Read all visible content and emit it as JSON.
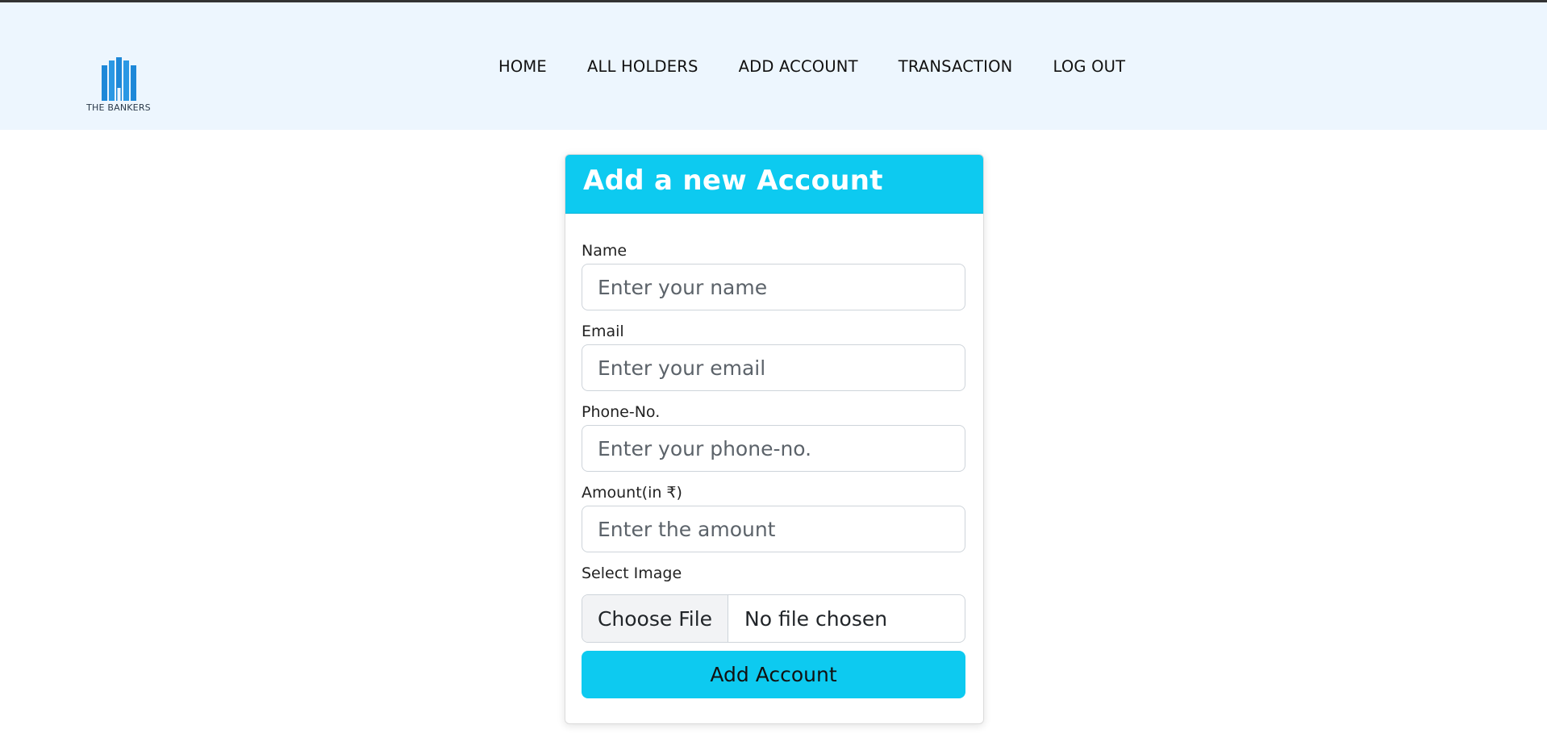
{
  "brand": {
    "name": "THE BANKERS",
    "logo_icon": "building-logo-icon",
    "logo_color": "#1e88d8"
  },
  "nav": {
    "items": [
      {
        "label": "HOME"
      },
      {
        "label": "ALL HOLDERS"
      },
      {
        "label": "ADD ACCOUNT"
      },
      {
        "label": "TRANSACTION"
      },
      {
        "label": "LOG OUT"
      }
    ]
  },
  "form": {
    "title": "Add a new Account",
    "fields": {
      "name": {
        "label": "Name",
        "placeholder": "Enter your name",
        "value": ""
      },
      "email": {
        "label": "Email",
        "placeholder": "Enter your email",
        "value": ""
      },
      "phone": {
        "label": "Phone-No.",
        "placeholder": "Enter your phone-no.",
        "value": ""
      },
      "amount": {
        "label": "Amount(in ₹)",
        "placeholder": "Enter the amount",
        "value": ""
      }
    },
    "image": {
      "label": "Select Image",
      "button_label": "Choose File",
      "status": "No file chosen"
    },
    "submit_label": "Add Account"
  },
  "colors": {
    "accent": "#0dcaf0",
    "navbar_bg": "#edf6fe"
  }
}
